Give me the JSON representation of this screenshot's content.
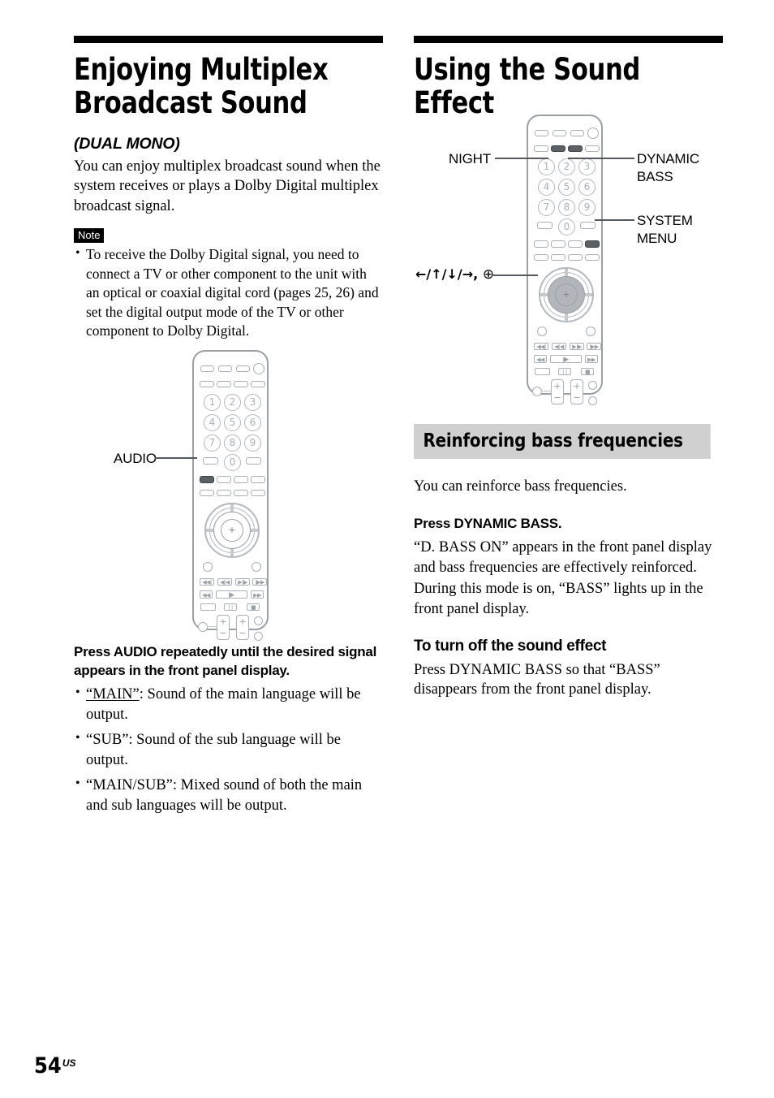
{
  "left_column": {
    "chapter_title": "Enjoying Multiplex Broadcast Sound",
    "subtitle": "(DUAL MONO)",
    "intro": "You can enjoy multiplex broadcast sound when the system receives or plays a Dolby Digital multiplex broadcast signal.",
    "note_tag": "Note",
    "note_items": [
      "To receive the Dolby Digital signal, you need to connect a TV or other component to the unit with an optical or coaxial digital cord (pages 25, 26) and set the digital output mode of the TV or other component to Dolby Digital."
    ],
    "remote_callouts": [
      {
        "label": "AUDIO"
      }
    ],
    "step_instruction": "Press AUDIO repeatedly until the desired signal appears in the front panel display.",
    "options": [
      {
        "term": "“MAIN”",
        "underlined": true,
        "text": ": Sound of the main language will be output."
      },
      {
        "term": "“SUB”",
        "underlined": false,
        "text": ": Sound of the sub language will be output."
      },
      {
        "term": "“MAIN/SUB”",
        "underlined": false,
        "text": ": Mixed sound of both the main and sub languages will be output."
      }
    ]
  },
  "right_column": {
    "chapter_title": "Using the Sound Effect",
    "remote_callouts": [
      {
        "label": "NIGHT"
      },
      {
        "label": "DYNAMIC BASS",
        "line1": "DYNAMIC",
        "line2": "BASS"
      },
      {
        "label": "SYSTEM MENU",
        "line1": "SYSTEM",
        "line2": "MENU"
      },
      {
        "label": "←/↑/↓/→, ⊕",
        "arrows": "←/↑/↓/→,",
        "enter": "⊕"
      }
    ],
    "banner_heading": "Reinforcing bass frequencies",
    "intro": "You can reinforce bass frequencies.",
    "step_instruction": "Press DYNAMIC BASS.",
    "result_paragraph_1": "“D. BASS ON” appears in the front panel display and bass frequencies are effectively reinforced.",
    "result_paragraph_2": "During this mode is on, “BASS” lights up in the front panel display.",
    "turn_off_heading": "To turn off the sound effect",
    "turn_off_text": "Press DYNAMIC BASS so that “BASS” disappears from the front panel display."
  },
  "remote_keypad": {
    "digits": [
      "1",
      "2",
      "3",
      "4",
      "5",
      "6",
      "7",
      "8",
      "9"
    ],
    "zero": "0",
    "power_glyph": "⏻"
  },
  "remote_transport": {
    "row1": [
      "◀◀|",
      "◀|◀",
      "▶|▶",
      "|▶▶"
    ],
    "row2": [
      "◀◀",
      "▶",
      "▶▶"
    ],
    "row3": [
      "",
      "| |",
      "■"
    ],
    "rocker_plus": "+",
    "rocker_minus": "−"
  },
  "footer": {
    "page_number": "54",
    "page_suffix": "US"
  },
  "colors": {
    "rule": "#000000",
    "banner_bg": "#d0d0d0",
    "remote_outline": "#9aa0a6",
    "highlight_button": "#5b6065",
    "dpad_fill": "#b2b6bb",
    "leader_line": "#555a5e"
  }
}
